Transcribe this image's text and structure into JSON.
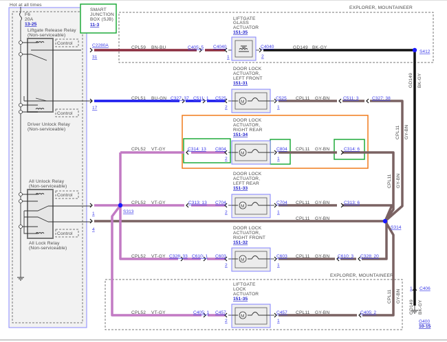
{
  "header": {
    "hot_at_all_times": "Hot at all times"
  },
  "fuse": {
    "name": "F6",
    "rating": "20A",
    "ref": "13-25"
  },
  "sjb": {
    "line1": "SMART",
    "line2": "JUNCTION",
    "line3": "BOX (SJB)",
    "ref": "11-3"
  },
  "relays": [
    {
      "name": "Liftgate Release Relay",
      "note": "(Non-serviceable)",
      "control": "Control"
    },
    {
      "name": "Driver Unlock Relay",
      "note": "(Non-serviceable)",
      "control": "Control"
    },
    {
      "name": "All Unlock Relay",
      "note": "(Non-serviceable)",
      "control": "Control"
    },
    {
      "name": "All Lock Relay",
      "note": "(Non-serviceable)",
      "control": "Control"
    }
  ],
  "sjb_pins": {
    "connector": "C2280A",
    "p31": "31",
    "p17": "17",
    "p1": "1",
    "p4": "4"
  },
  "option_label": "EXPLORER, MOUNTAINEER",
  "colors": {
    "bn_bu": "#8b2d3f",
    "bu_gn": "#1a1aee",
    "bk_gy": "#111111",
    "gy_bn": "#7a6262",
    "vt_gy": "#c27ac4",
    "splice": "#1a1aff",
    "highlight_orange": "#f07a1a",
    "highlight_green": "#1faa3a"
  },
  "components": {
    "glass": {
      "l1": "LIFTGATE",
      "l2": "GLASS",
      "l3": "ACTUATOR",
      "ref": "151-35",
      "c_left": "C4040",
      "p_left": "1",
      "c_right": "C4040",
      "p_right": "2"
    },
    "lf": {
      "l1": "DOOR LOCK",
      "l2": "ACTUATOR,",
      "l3": "LEFT FRONT",
      "ref": "151-31",
      "c_left": "C525",
      "p_left": "2",
      "c_right": "C525",
      "p_right": "1",
      "motor": "M"
    },
    "rr": {
      "l1": "DOOR LOCK",
      "l2": "ACTUATOR,",
      "l3": "RIGHT REAR",
      "ref": "151-34",
      "c_left": "C804",
      "p_left": "2",
      "c_right": "C804",
      "p_right": "1",
      "motor": "M"
    },
    "lr": {
      "l1": "DOOR LOCK",
      "l2": "ACTUATOR,",
      "l3": "LEFT REAR",
      "ref": "151-33",
      "c_left": "C704",
      "p_left": "2",
      "c_right": "C704",
      "p_right": "1",
      "motor": "M"
    },
    "rf": {
      "l1": "DOOR LOCK",
      "l2": "ACTUATOR,",
      "l3": "RIGHT FRONT",
      "ref": "151-32",
      "c_left": "C603",
      "p_left": "2",
      "c_right": "C603",
      "p_right": "1",
      "motor": "M"
    },
    "lock": {
      "l1": "LIFTGATE",
      "l2": "LOCK",
      "l3": "ACTUATOR",
      "ref": "151-35",
      "c_left": "C457",
      "p_left": "2",
      "c_right": "C457",
      "p_right": "1",
      "motor": "M"
    }
  },
  "circuits": {
    "cpl59": {
      "name": "CPL59",
      "color": "BN-BU"
    },
    "cpl51": {
      "name": "CPL51",
      "color": "BU-GN"
    },
    "cpl52": {
      "name": "CPL52",
      "color": "VT-GY"
    },
    "cpl11": {
      "name": "CPL11",
      "color": "GY-BN"
    },
    "gd149": {
      "name": "GD149",
      "color": "BK-GY"
    }
  },
  "inline_connectors": {
    "c405_5": "C405: 5",
    "c327_37": "C327: 37",
    "c511_1": "C511: 1",
    "c511_3": "C511: 3",
    "c327_38": "C327: 38",
    "c314_13": "C314: 13",
    "c314_6": "C314: 6",
    "c313_13": "C313: 13",
    "c313_6": "C313: 6",
    "c328_33": "C328: 33",
    "c610_1": "C610: 1",
    "c610_3": "C610: 3",
    "c328_20": "C328: 20",
    "c405_1": "C405: 1",
    "c405_2": "C405: 2",
    "c406": "C406",
    "c406_pin": "1"
  },
  "splices": {
    "s412": "S412",
    "s313": "S313",
    "s314": "S314"
  },
  "ground": {
    "name": "G400",
    "ref": "10-15"
  }
}
